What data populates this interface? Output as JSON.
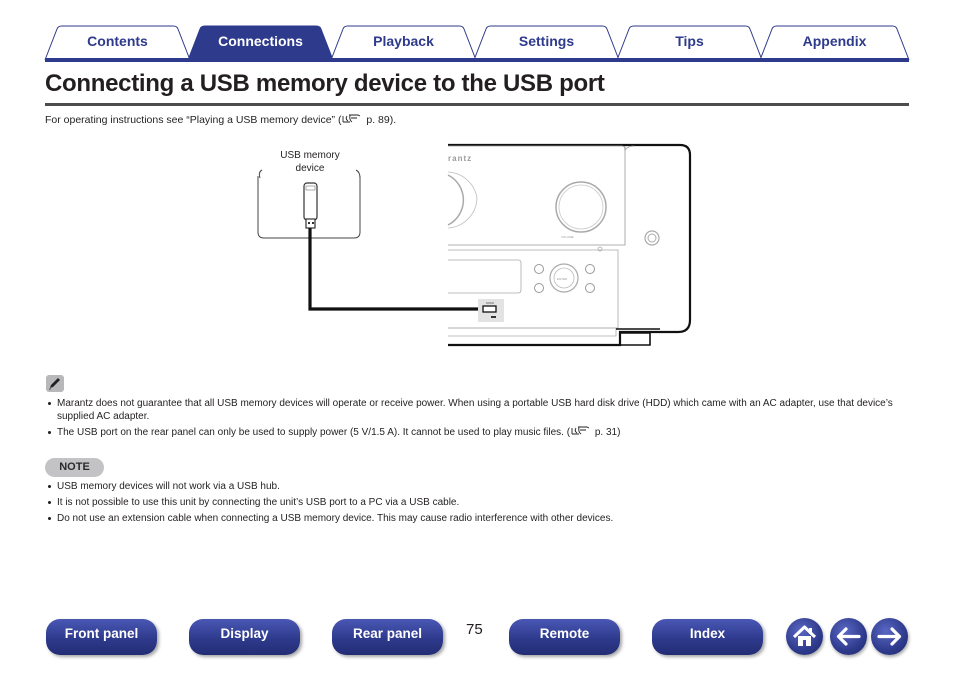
{
  "tabs": [
    {
      "label": "Contents",
      "active": false
    },
    {
      "label": "Connections",
      "active": true
    },
    {
      "label": "Playback",
      "active": false
    },
    {
      "label": "Settings",
      "active": false
    },
    {
      "label": "Tips",
      "active": false
    },
    {
      "label": "Appendix",
      "active": false
    }
  ],
  "page": {
    "title": "Connecting a USB memory device to the USB port",
    "intro_text": "For operating instructions see “Playing a USB memory device”  (",
    "intro_ref": "p. 89).",
    "number": "75"
  },
  "diagram": {
    "usb_label_line1": "USB memory",
    "usb_label_line2": "device",
    "brand_text": "rantz",
    "volume_label": "VOLUME",
    "enter_label": "ENTER",
    "port_label": "5V/1.5A"
  },
  "info_bullets": [
    {
      "text": "Marantz does not guarantee that all USB memory devices will operate or receive power. When using a portable USB hard disk drive (HDD) which came with an AC adapter, use that device’s supplied AC adapter."
    },
    {
      "text": "The USB port on the rear panel can only be used to supply power (5 V/1.5 A). It cannot be used to play music files.  (",
      "ref": "p. 31)"
    }
  ],
  "note": {
    "badge": "NOTE",
    "bullets": [
      "USB memory devices will not work via a USB hub.",
      "It is not possible to use this unit by connecting the unit’s USB port to a PC via a USB cable.",
      "Do not use an extension cable when connecting a USB memory device. This may cause radio interference with other devices."
    ]
  },
  "bottom_nav": {
    "front_panel": "Front panel",
    "display": "Display",
    "rear_panel": "Rear panel",
    "remote": "Remote",
    "index": "Index",
    "home_icon": "home-icon",
    "back_icon": "arrow-left-icon",
    "forward_icon": "arrow-right-icon"
  },
  "colors": {
    "brand_blue": "#2e3a8c",
    "text": "#231f20",
    "badge_gray": "#c3c3c5"
  }
}
